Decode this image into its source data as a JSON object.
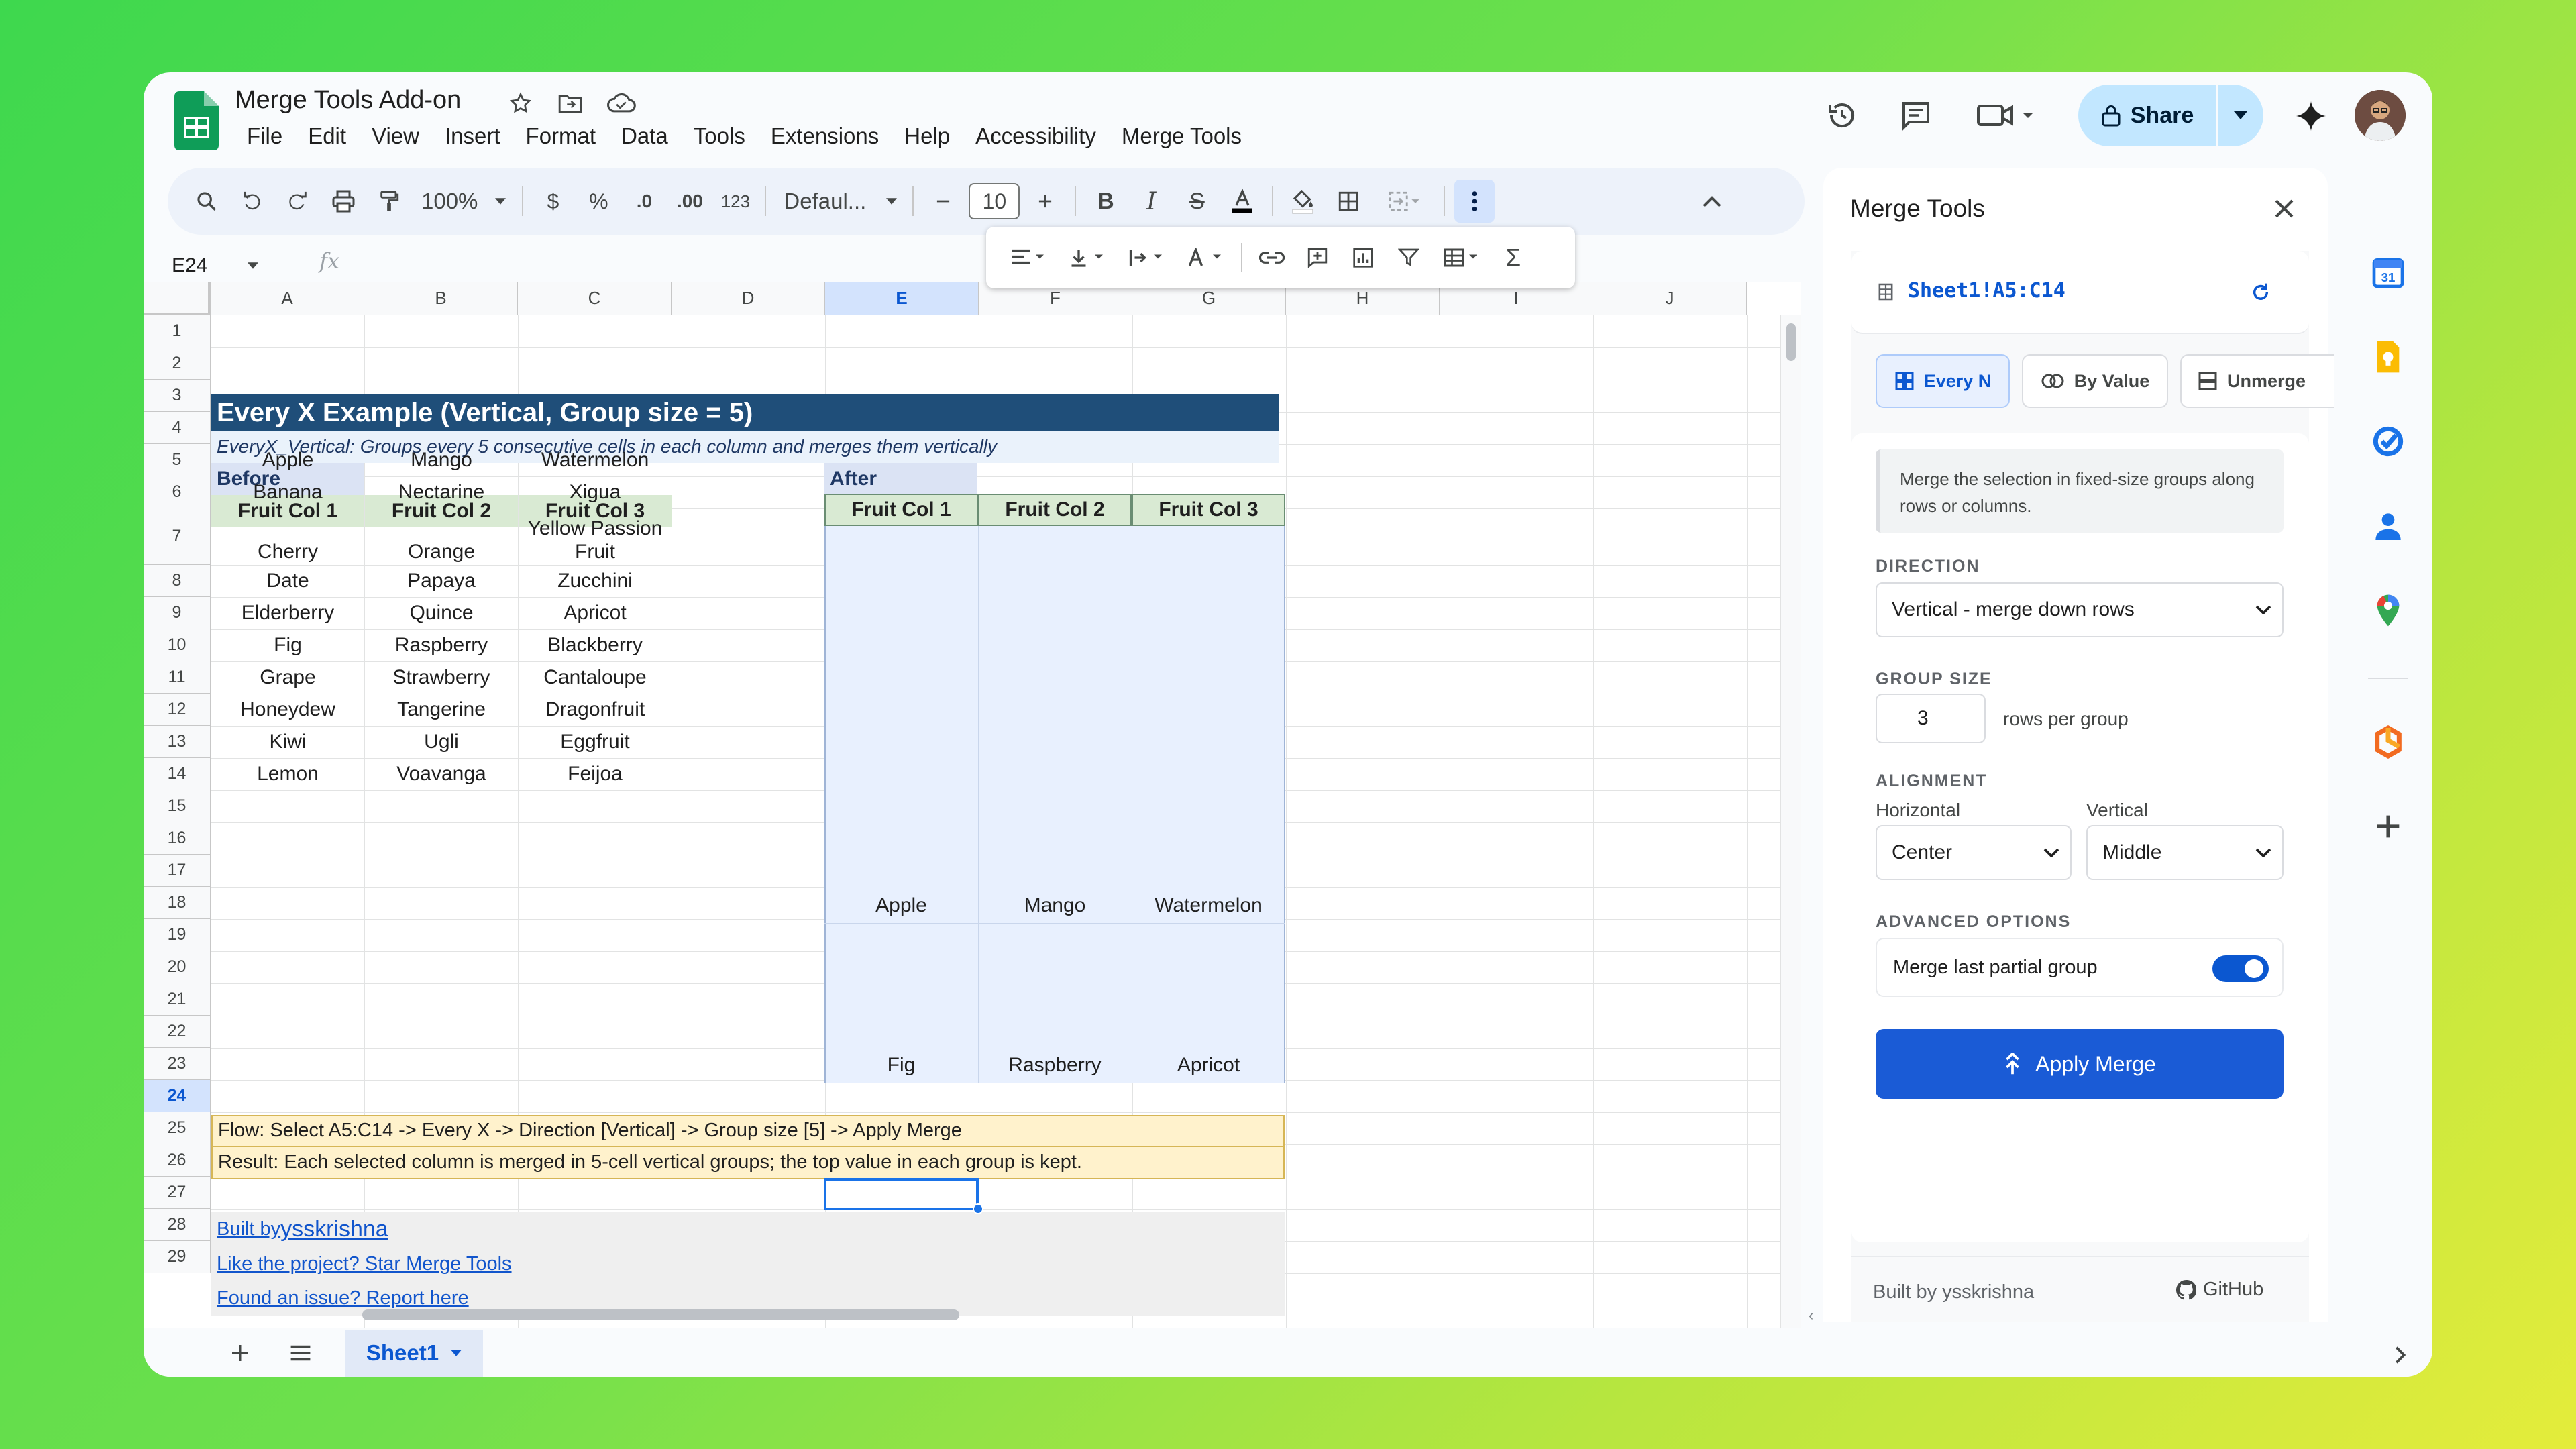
{
  "app": {
    "doc_title": "Merge Tools Add-on",
    "menu": [
      "File",
      "Edit",
      "View",
      "Insert",
      "Format",
      "Data",
      "Tools",
      "Extensions",
      "Help",
      "Accessibility",
      "Merge Tools"
    ],
    "share_label": "Share"
  },
  "toolbar": {
    "zoom": "100%",
    "currency": "$",
    "percent": "%",
    "dec_decrease": ".0",
    "dec_increase": ".00",
    "format_123": "123",
    "font": "Defaul...",
    "font_size": "10",
    "icons": [
      "search-icon",
      "undo-icon",
      "redo-icon",
      "print-icon",
      "paint-format-icon",
      "bold-icon",
      "italic-icon",
      "strikethrough-icon",
      "text-color-icon",
      "fill-color-icon",
      "borders-icon",
      "merge-cells-icon",
      "more-vert-icon",
      "collapse-icon"
    ]
  },
  "floating_toolbar": {
    "icons": [
      "align-horizontal-icon",
      "align-vertical-icon",
      "text-wrap-icon",
      "text-rotate-icon",
      "link-icon",
      "comment-icon",
      "chart-icon",
      "filter-icon",
      "table-view-icon",
      "functions-icon"
    ]
  },
  "formula_bar": {
    "name_box": "E24",
    "fx": "fx",
    "formula": ""
  },
  "grid": {
    "columns": [
      "A",
      "B",
      "C",
      "D",
      "E",
      "F",
      "G",
      "H",
      "I",
      "J"
    ],
    "rows": [
      "1",
      "2",
      "3",
      "4",
      "5",
      "6",
      "7",
      "8",
      "9",
      "10",
      "11",
      "12",
      "13",
      "14",
      "15",
      "16",
      "17",
      "18",
      "19",
      "20",
      "21",
      "22",
      "23",
      "24",
      "25",
      "26",
      "27",
      "28",
      "29"
    ],
    "active_row": "24",
    "active_col": "E",
    "title": "Every X Example (Vertical, Group size = 5)",
    "description": "EveryX_Vertical: Groups every 5 consecutive cells in each column and merges them vertically",
    "before_label": "Before",
    "after_label": "After",
    "headers": [
      "Fruit Col 1",
      "Fruit Col 2",
      "Fruit Col 3"
    ],
    "before_rows": [
      [
        "Apple",
        "Mango",
        "Watermelon"
      ],
      [
        "Banana",
        "Nectarine",
        "Xigua"
      ],
      [
        "Cherry",
        "Orange",
        "Yellow Passion Fruit"
      ],
      [
        "Date",
        "Papaya",
        "Zucchini"
      ],
      [
        "Elderberry",
        "Quince",
        "Apricot"
      ],
      [
        "Fig",
        "Raspberry",
        "Blackberry"
      ],
      [
        "Grape",
        "Strawberry",
        "Cantaloupe"
      ],
      [
        "Honeydew",
        "Tangerine",
        "Dragonfruit"
      ],
      [
        "Kiwi",
        "Ugli",
        "Eggfruit"
      ],
      [
        "Lemon",
        "Voavanga",
        "Feijoa"
      ]
    ],
    "after_groups": [
      [
        "Apple",
        "Mango",
        "Watermelon"
      ],
      [
        "Fig",
        "Raspberry",
        "Apricot"
      ]
    ],
    "flow": "Flow: Select A5:C14 -> Every X -> Direction [Vertical] -> Group size [5] -> Apply Merge",
    "result": "Result: Each selected column is merged in 5-cell vertical groups; the top value in each group is kept.",
    "built_by_prefix": "Built by ",
    "built_by_name": "ysskrishna",
    "like_project": "Like the project? Star Merge Tools",
    "report_issue": "Found an issue? Report here"
  },
  "sheet_tabs": {
    "active": "Sheet1"
  },
  "panel": {
    "title": "Merge Tools",
    "range": "Sheet1!A5:C14",
    "tabs": [
      "Every N",
      "By Value",
      "Unmerge"
    ],
    "description": "Merge the selection in fixed-size groups along rows or columns.",
    "direction_label": "DIRECTION",
    "direction_value": "Vertical - merge down rows",
    "group_size_label": "GROUP SIZE",
    "group_size_value": "3",
    "group_size_unit": "rows per group",
    "alignment_label": "ALIGNMENT",
    "horizontal_label": "Horizontal",
    "horizontal_value": "Center",
    "vertical_label": "Vertical",
    "vertical_value": "Middle",
    "advanced_label": "ADVANCED OPTIONS",
    "merge_partial_label": "Merge last partial group",
    "merge_partial_on": true,
    "apply_label": "Apply Merge",
    "footer_built_by": "Built by ysskrishna",
    "footer_github": "GitHub"
  },
  "colors": {
    "title_band": "#1f4e79",
    "before_band": "#dbe3f4",
    "header_fill": "#d9ead3",
    "merged_fill": "#e8f0fe",
    "note_fill": "#fff2cc",
    "link_band": "#efefef",
    "accent": "#0b57d0",
    "primary_button": "#1a5bd6"
  }
}
